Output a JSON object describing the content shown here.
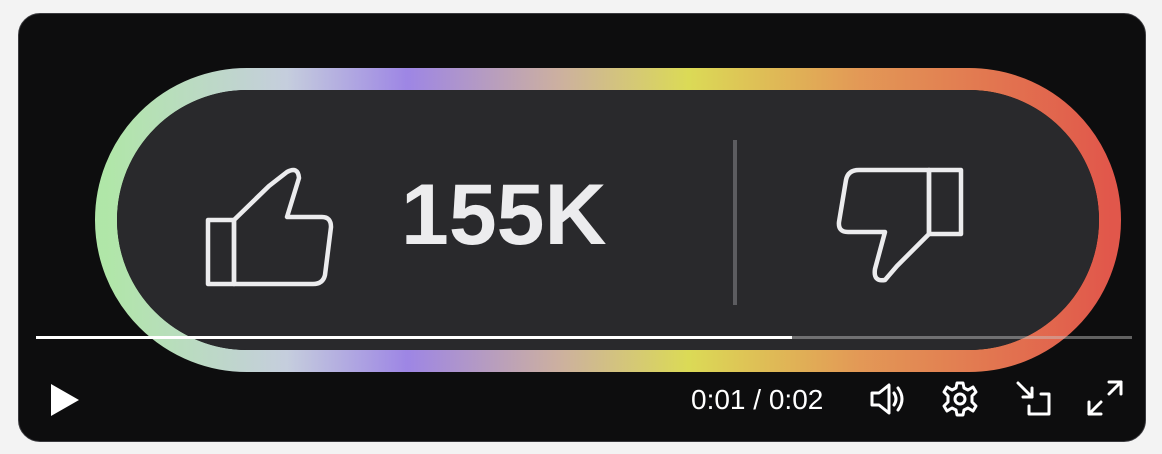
{
  "video": {
    "like_count": "155K"
  },
  "player": {
    "progress_fraction": 0.69,
    "current_time": "0:01",
    "separator": "/",
    "duration": "0:02"
  },
  "controls": {
    "play_icon": "play-icon",
    "volume_icon": "volume-icon",
    "settings_icon": "gear-icon",
    "popout_icon": "picture-in-picture-icon",
    "fullscreen_icon": "fullscreen-icon"
  },
  "colors": {
    "player_background": "#0d0d0e",
    "pill_background": "#29292c",
    "progress_fill": "#ffffff",
    "gradient_green": "#b8f0b0",
    "gradient_purple": "#a58cf0",
    "gradient_yellow": "#e6e55a",
    "gradient_red": "#ec5b4e"
  }
}
